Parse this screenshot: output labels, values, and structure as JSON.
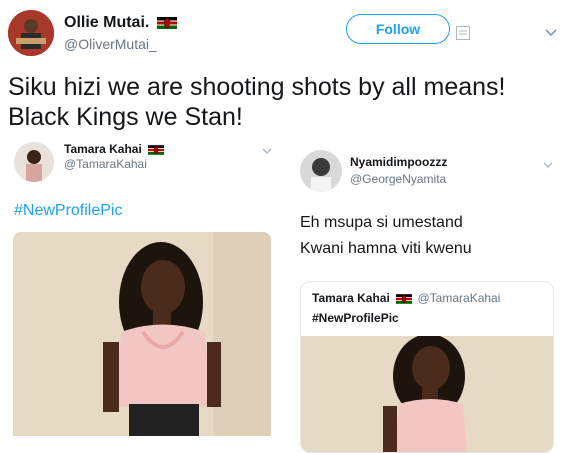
{
  "author": {
    "name": "Ollie Mutai.",
    "handle": "@OliverMutai_",
    "follow_label": "Follow"
  },
  "tweet_text": "Siku hizi we are shooting shots by all means! Black Kings we Stan!",
  "left_card": {
    "name": "Tamara Kahai",
    "handle": "@TamaraKahai",
    "hashtag": "#NewProfilePic"
  },
  "right_card": {
    "name": "Nyamidimpoozzz",
    "handle": "@GeorgeNyamita",
    "text_line1": "Eh msupa si umestand",
    "text_line2": "Kwani hamna viti kwenu",
    "quote": {
      "name": "Tamara Kahai",
      "handle": "@TamaraKahai",
      "hashtag": "#NewProfilePic"
    }
  },
  "colors": {
    "accent": "#1da1f2",
    "text": "#14171a",
    "secondary": "#657786",
    "photo_bg": "#e6dac4",
    "blouse": "#f2c7c3"
  },
  "icons": [
    "flag-kenya-icon",
    "chevron-down-icon",
    "grid-icon"
  ]
}
